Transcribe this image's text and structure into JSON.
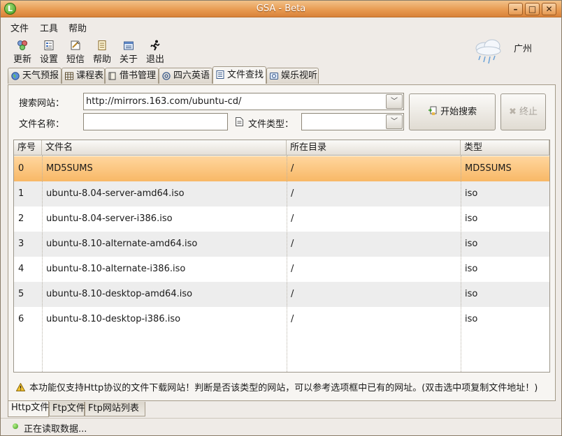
{
  "window": {
    "title": "GSA - Beta",
    "app_icon_letter": "L",
    "minimize": "–",
    "maximize": "□",
    "close": "✕"
  },
  "menu": {
    "file": "文件",
    "tools": "工具",
    "help": "帮助"
  },
  "toolbar": {
    "update": "更新",
    "settings": "设置",
    "sms": "短信",
    "help": "帮助",
    "about": "关于",
    "exit": "退出"
  },
  "weather": {
    "city": "广州",
    "icon": "rain-cloud-icon"
  },
  "tabs": {
    "weather": "天气预报",
    "schedule": "课程表",
    "library": "借书管理",
    "cet": "四六英语",
    "file_search": "文件查找",
    "entertainment": "娱乐视听"
  },
  "search": {
    "site_label": "搜索网站：",
    "site_value": "http://mirrors.163.com/ubuntu-cd/",
    "name_label": "文件名称：",
    "name_value": "",
    "type_label": "文件类型：",
    "type_value": "",
    "start_button": "开始搜索",
    "stop_button": "终止"
  },
  "table": {
    "headers": [
      "序号",
      "文件名",
      "所在目录",
      "类型"
    ],
    "rows": [
      [
        "0",
        "MD5SUMS",
        "/",
        "MD5SUMS"
      ],
      [
        "1",
        "ubuntu-8.04-server-amd64.iso",
        "/",
        "iso"
      ],
      [
        "2",
        "ubuntu-8.04-server-i386.iso",
        "/",
        "iso"
      ],
      [
        "3",
        "ubuntu-8.10-alternate-amd64.iso",
        "/",
        "iso"
      ],
      [
        "4",
        "ubuntu-8.10-alternate-i386.iso",
        "/",
        "iso"
      ],
      [
        "5",
        "ubuntu-8.10-desktop-amd64.iso",
        "/",
        "iso"
      ],
      [
        "6",
        "ubuntu-8.10-desktop-i386.iso",
        "/",
        "iso"
      ]
    ],
    "selected_row": 0
  },
  "notice": "本功能仅支持Http协议的文件下载网站！判断是否该类型的网站，可以参考选项框中已有的网址。(双击选中项复制文件地址！)",
  "bottom_tabs": {
    "http": "Http文件",
    "ftp": "Ftp文件",
    "ftp_list": "Ftp网站列表"
  },
  "status": {
    "text": "正在读取数据..."
  },
  "colors": {
    "title_bar": "#e89b52",
    "selection": "#f8b866",
    "status_ok": "#3b9a1c"
  }
}
